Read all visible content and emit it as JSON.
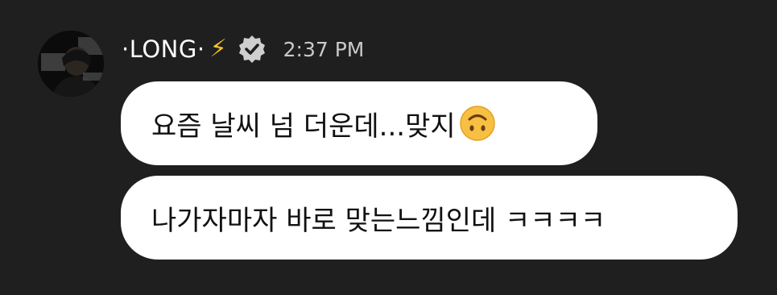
{
  "message": {
    "username": "·LONG·",
    "status_emoji": "⚡",
    "verified_icon": "verified-badge-icon",
    "time": "2:37 PM",
    "avatar": "profile-photo"
  },
  "bubbles": [
    {
      "text": "요즘 날씨 넘 더운데...맞지",
      "emoji": "upside-down-face-emoji"
    },
    {
      "text": "나가자마자 바로 맞는느낌인데 ㅋㅋㅋㅋ"
    }
  ],
  "colors": {
    "background": "#1f1f1f",
    "bubble": "#ffffff",
    "text": "#111111",
    "username": "#ffffff",
    "time": "#c9c9c9",
    "bolt": "#f6c12b"
  }
}
